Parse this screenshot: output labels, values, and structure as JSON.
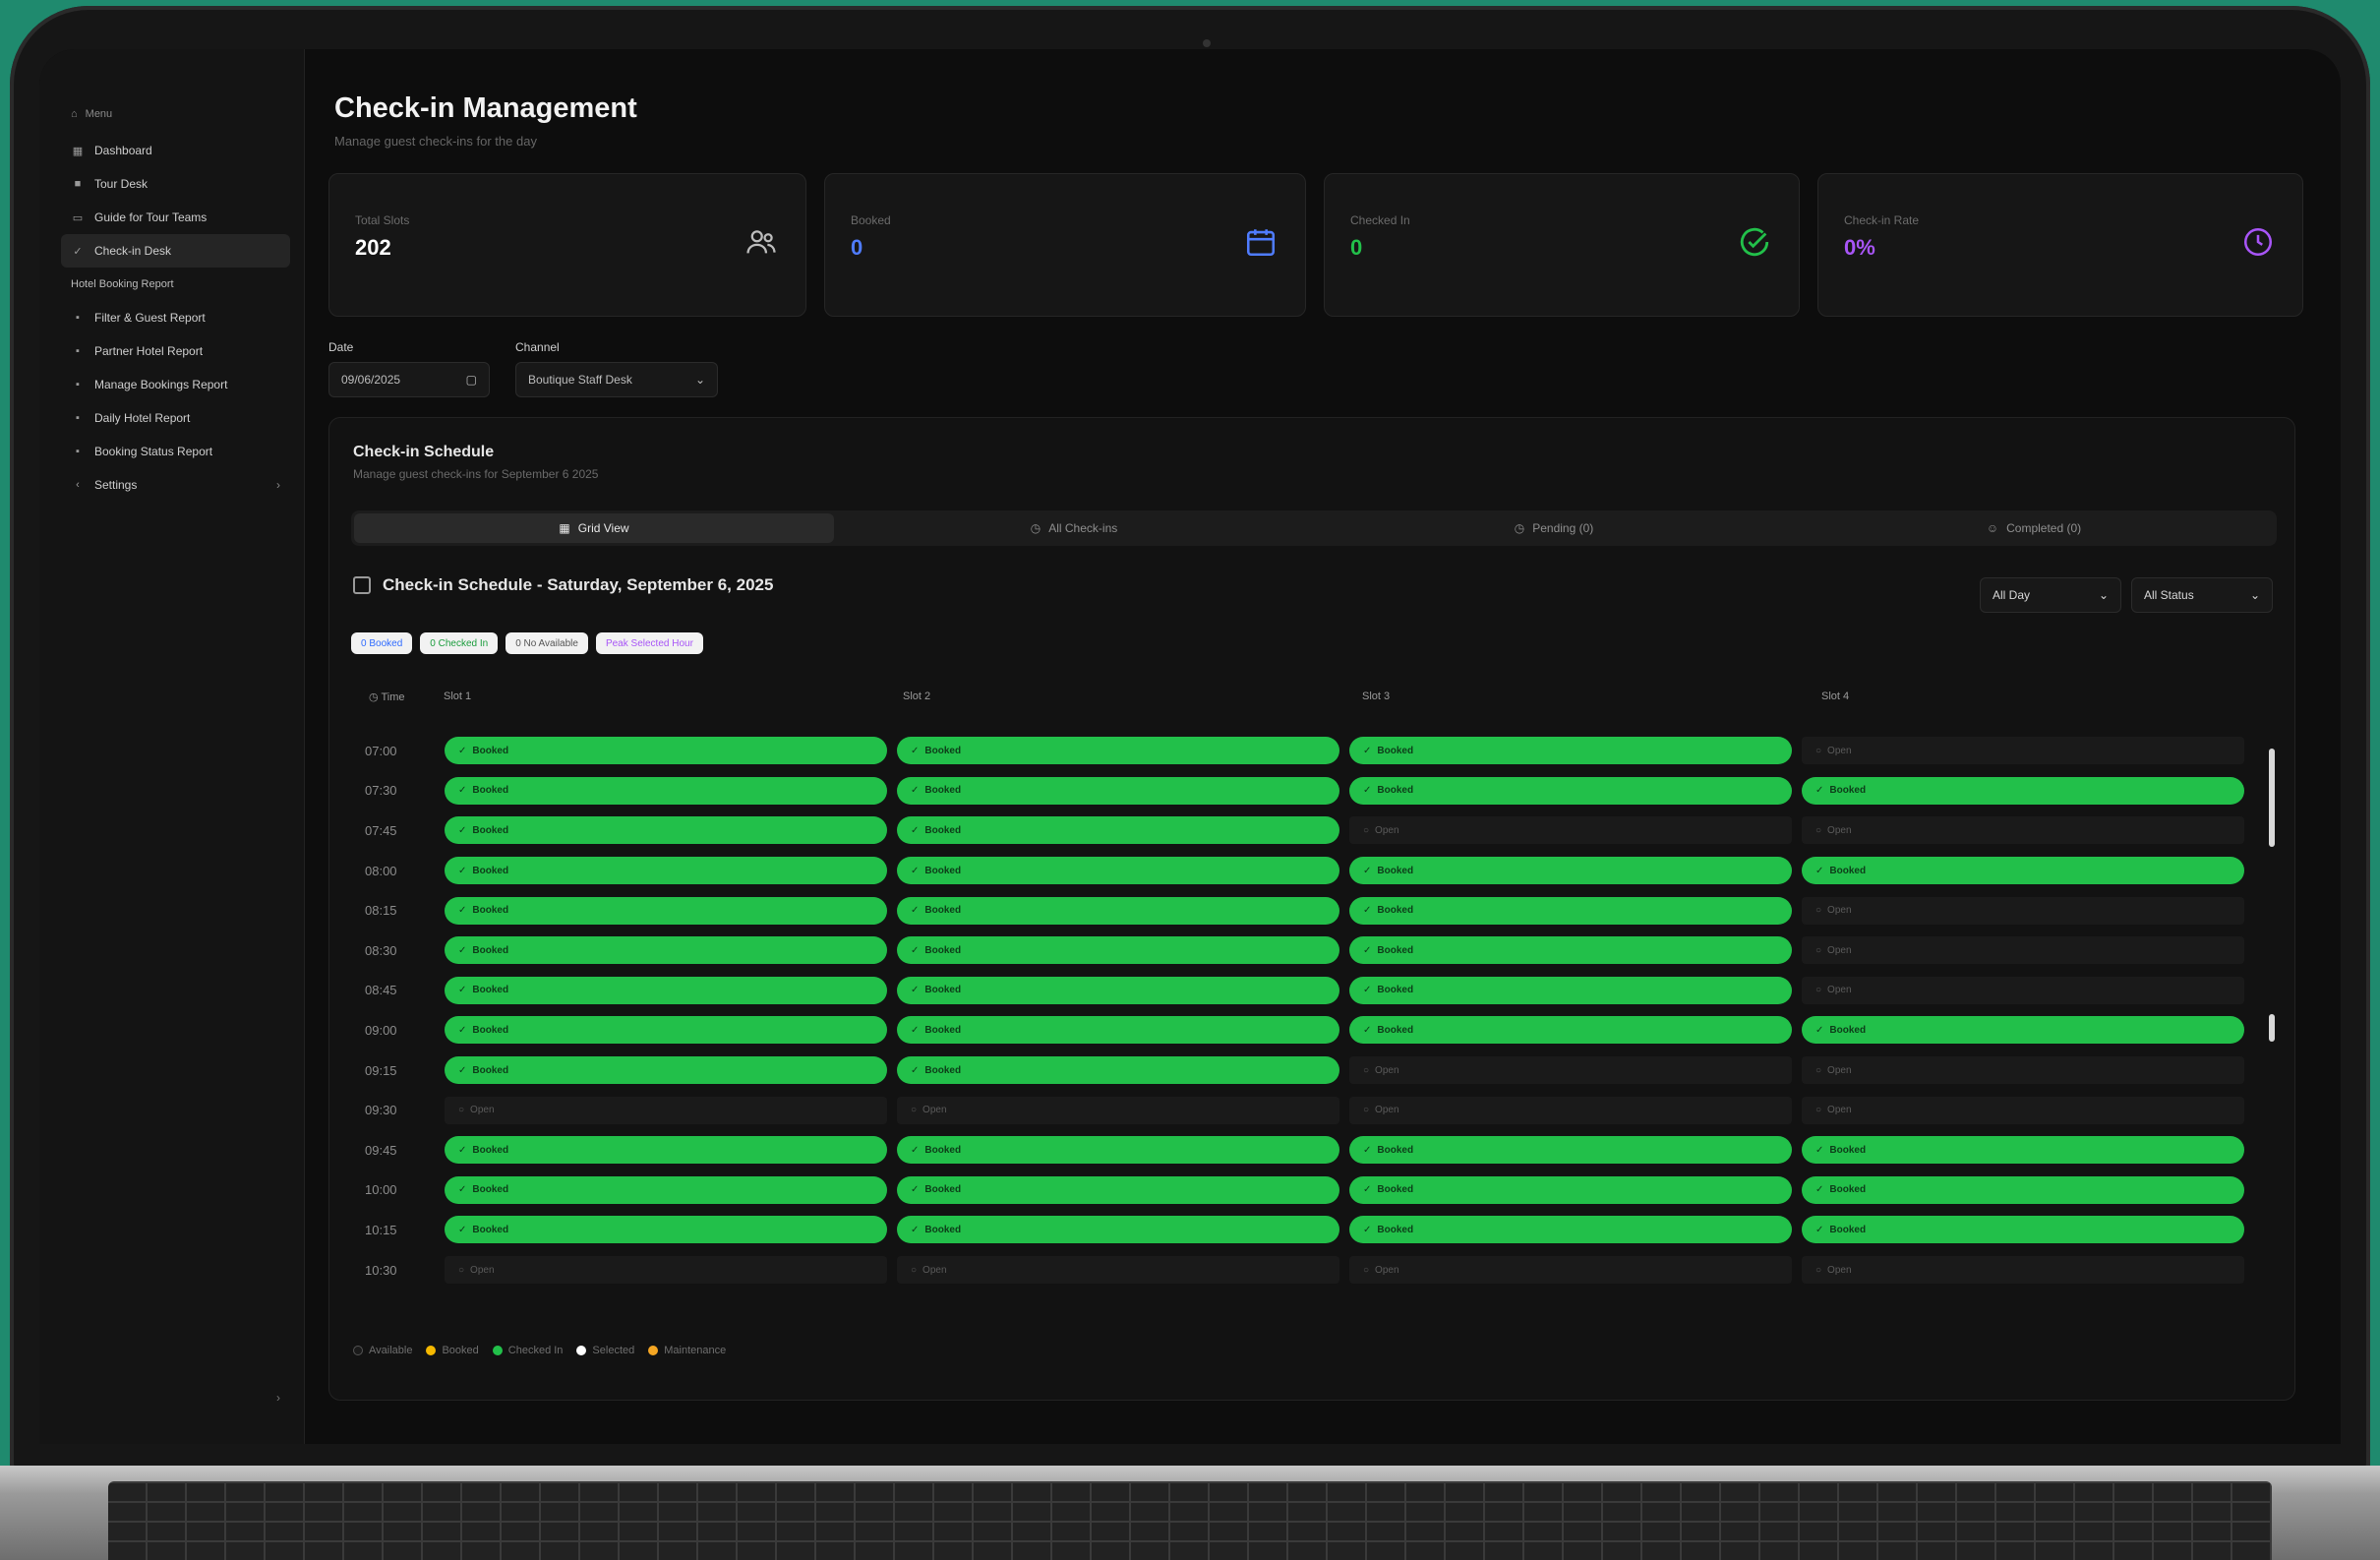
{
  "sidebar": {
    "group_label": "Menu",
    "items": [
      {
        "label": "Dashboard",
        "icon": "grid-icon"
      },
      {
        "label": "Tour Desk",
        "icon": "box-icon"
      },
      {
        "label": "Guide for Tour Teams",
        "icon": "bus-icon"
      },
      {
        "label": "Check-in Desk",
        "icon": "check-icon",
        "active": true
      }
    ],
    "section_label": "Hotel Booking Report",
    "report_items": [
      {
        "label": "Filter & Guest Report"
      },
      {
        "label": "Partner Hotel Report"
      },
      {
        "label": "Manage Bookings Report"
      },
      {
        "label": "Daily Hotel Report"
      },
      {
        "label": "Booking Status Report"
      }
    ],
    "settings_label": "Settings",
    "collapse_glyph": "›"
  },
  "header": {
    "title": "Check-in Management",
    "subtitle": "Manage guest check-ins for the day"
  },
  "stats": [
    {
      "label": "Total Slots",
      "value": "202",
      "color": "#ffffff",
      "icon": "users-icon"
    },
    {
      "label": "Booked",
      "value": "0",
      "color": "#4f7cff",
      "icon": "calendar-icon"
    },
    {
      "label": "Checked In",
      "value": "0",
      "color": "#22c04a",
      "icon": "check-circle-icon"
    },
    {
      "label": "Check-in Rate",
      "value": "0%",
      "color": "#a855f7",
      "icon": "clock-icon"
    }
  ],
  "filters": {
    "date_label": "Date",
    "date_value": "09/06/2025",
    "channel_label": "Channel",
    "channel_value": "Boutique Staff Desk"
  },
  "panel": {
    "title": "Check-in Schedule",
    "subtitle": "Manage guest check-ins for September 6 2025",
    "tabs": [
      {
        "label": "Grid View",
        "icon": "grid-icon",
        "active": true
      },
      {
        "label": "All Check-ins",
        "icon": "clock-icon"
      },
      {
        "label": "Pending (0)",
        "icon": "clock-icon"
      },
      {
        "label": "Completed (0)",
        "icon": "user-icon"
      }
    ],
    "schedule_title": "Check-in Schedule - Saturday, September 6, 2025",
    "select_day": "All Day",
    "select_status": "All Status",
    "chips": [
      {
        "label": "0 Booked",
        "color": "#2f6bff"
      },
      {
        "label": "0 Checked In",
        "color": "#1a9c3c"
      },
      {
        "label": "0 No Available",
        "color": "#555555"
      },
      {
        "label": "Peak Selected Hour",
        "color": "#a855f7"
      }
    ]
  },
  "grid": {
    "time_header": "Time",
    "columns": [
      "Slot 1",
      "Slot 2",
      "Slot 3",
      "Slot 4"
    ],
    "rows": [
      {
        "time": "07:00",
        "slots": [
          [
            "booked",
            "Booked"
          ],
          [
            "booked",
            "Booked"
          ],
          [
            "booked",
            "Booked"
          ],
          [
            "open",
            "Open"
          ]
        ]
      },
      {
        "time": "07:30",
        "slots": [
          [
            "booked",
            "Booked"
          ],
          [
            "booked",
            "Booked"
          ],
          [
            "booked",
            "Booked"
          ],
          [
            "booked",
            "Booked"
          ]
        ]
      },
      {
        "time": "07:45",
        "slots": [
          [
            "booked",
            "Booked"
          ],
          [
            "booked",
            "Booked"
          ],
          [
            "open",
            "Open"
          ],
          [
            "open",
            "Open"
          ]
        ]
      },
      {
        "time": "08:00",
        "slots": [
          [
            "booked",
            "Booked"
          ],
          [
            "booked",
            "Booked"
          ],
          [
            "booked",
            "Booked"
          ],
          [
            "booked",
            "Booked"
          ]
        ]
      },
      {
        "time": "08:15",
        "slots": [
          [
            "booked",
            "Booked"
          ],
          [
            "booked",
            "Booked"
          ],
          [
            "booked",
            "Booked"
          ],
          [
            "open",
            "Open"
          ]
        ]
      },
      {
        "time": "08:30",
        "slots": [
          [
            "booked",
            "Booked"
          ],
          [
            "booked",
            "Booked"
          ],
          [
            "booked",
            "Booked"
          ],
          [
            "open",
            "Open"
          ]
        ]
      },
      {
        "time": "08:45",
        "slots": [
          [
            "booked",
            "Booked"
          ],
          [
            "booked",
            "Booked"
          ],
          [
            "booked",
            "Booked"
          ],
          [
            "open",
            "Open"
          ]
        ]
      },
      {
        "time": "09:00",
        "slots": [
          [
            "booked",
            "Booked"
          ],
          [
            "booked",
            "Booked"
          ],
          [
            "booked",
            "Booked"
          ],
          [
            "booked",
            "Booked"
          ]
        ]
      },
      {
        "time": "09:15",
        "slots": [
          [
            "booked",
            "Booked"
          ],
          [
            "booked",
            "Booked"
          ],
          [
            "open",
            "Open"
          ],
          [
            "open",
            "Open"
          ]
        ]
      },
      {
        "time": "09:30",
        "slots": [
          [
            "open",
            "Open"
          ],
          [
            "open",
            "Open"
          ],
          [
            "open",
            "Open"
          ],
          [
            "open",
            "Open"
          ]
        ]
      },
      {
        "time": "09:45",
        "slots": [
          [
            "booked",
            "Booked"
          ],
          [
            "booked",
            "Booked"
          ],
          [
            "booked",
            "Booked"
          ],
          [
            "booked",
            "Booked"
          ]
        ]
      },
      {
        "time": "10:00",
        "slots": [
          [
            "booked",
            "Booked"
          ],
          [
            "booked",
            "Booked"
          ],
          [
            "booked",
            "Booked"
          ],
          [
            "booked",
            "Booked"
          ]
        ]
      },
      {
        "time": "10:15",
        "slots": [
          [
            "booked",
            "Booked"
          ],
          [
            "booked",
            "Booked"
          ],
          [
            "booked",
            "Booked"
          ],
          [
            "booked",
            "Booked"
          ]
        ]
      },
      {
        "time": "10:30",
        "slots": [
          [
            "open",
            "Open"
          ],
          [
            "open",
            "Open"
          ],
          [
            "open",
            "Open"
          ],
          [
            "open",
            "Open"
          ]
        ]
      }
    ]
  },
  "legend": [
    {
      "label": "Available",
      "color": "#1a1a1a"
    },
    {
      "label": "Booked",
      "color": "#f5b800"
    },
    {
      "label": "Checked In",
      "color": "#22c04a"
    },
    {
      "label": "Selected",
      "color": "#ffffff"
    },
    {
      "label": "Maintenance",
      "color": "#f5a623"
    }
  ]
}
